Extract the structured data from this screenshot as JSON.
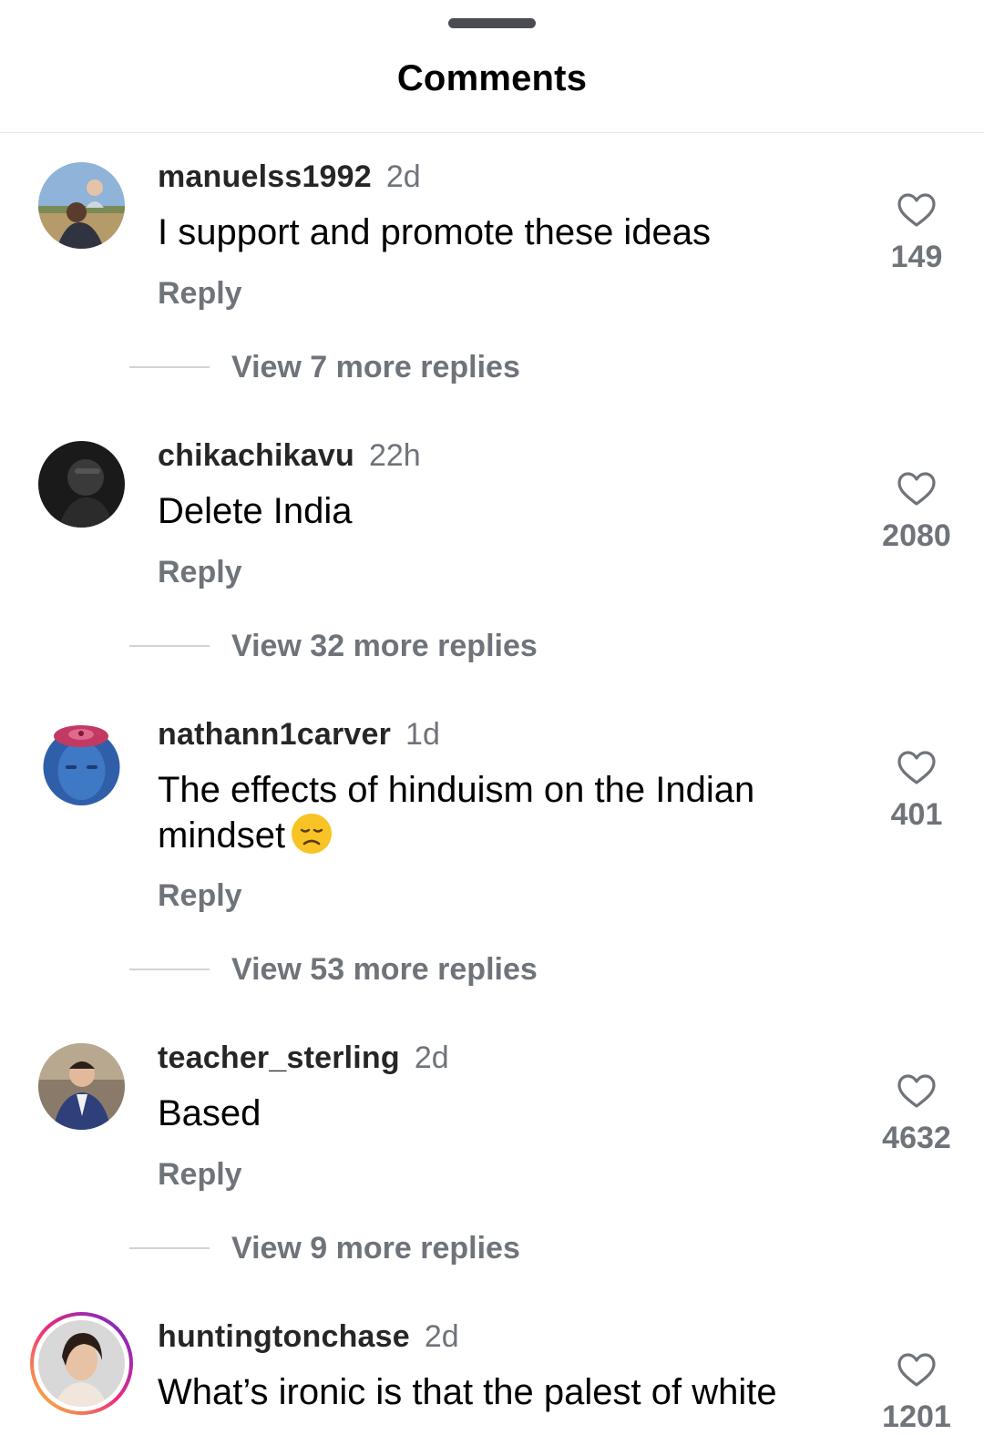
{
  "sheet": {
    "title": "Comments"
  },
  "comments": [
    {
      "username": "manuelss1992",
      "time": "2d",
      "text": "I support and promote these ideas",
      "reply_label": "Reply",
      "likes": "149",
      "view_replies": "View 7 more replies"
    },
    {
      "username": "chikachikavu",
      "time": "22h",
      "text": "Delete India",
      "reply_label": "Reply",
      "likes": "2080",
      "view_replies": "View 32 more replies"
    },
    {
      "username": "nathann1carver",
      "time": "1d",
      "text": "The effects of hinduism on the Indian mindset",
      "emoji": "disappointed-face-emoji",
      "reply_label": "Reply",
      "likes": "401",
      "view_replies": "View 53 more replies"
    },
    {
      "username": "teacher_sterling",
      "time": "2d",
      "text": "Based",
      "reply_label": "Reply",
      "likes": "4632",
      "view_replies": "View 9 more replies"
    },
    {
      "username": "huntingtonchase",
      "time": "2d",
      "text": "What’s ironic is that the palest of white",
      "likes": "1201"
    }
  ],
  "colors": {
    "username": "#262626",
    "secondary": "#6f737a",
    "story_ring_start": "#f9ce34",
    "story_ring_mid": "#ee2a7b",
    "story_ring_end": "#6228d7"
  },
  "icons": {
    "like": "heart-outline-icon"
  }
}
